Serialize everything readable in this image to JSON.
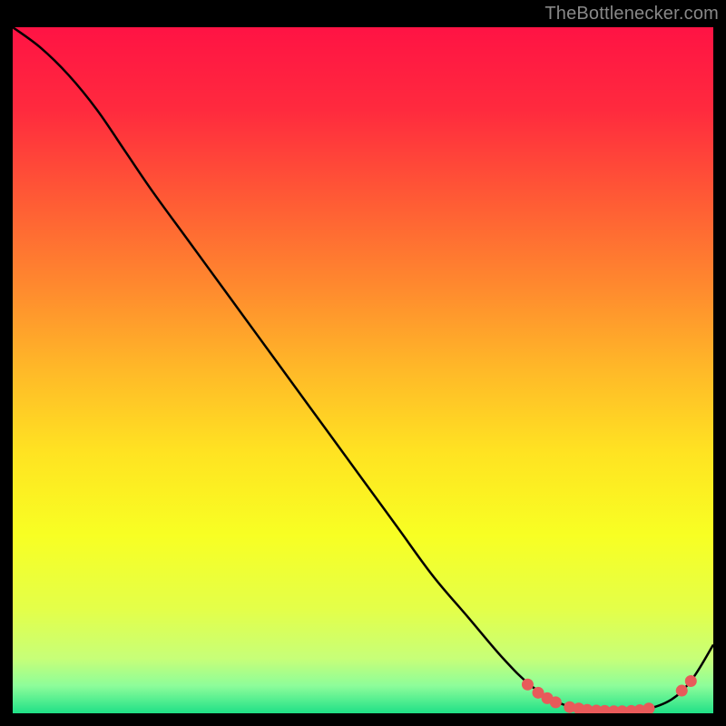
{
  "attribution": "TheBottlenecker.com",
  "chart_data": {
    "type": "line",
    "title": "",
    "xlabel": "",
    "ylabel": "",
    "xlim": [
      0,
      100
    ],
    "ylim": [
      0,
      100
    ],
    "series": [
      {
        "name": "curve",
        "x": [
          0,
          4,
          8,
          12,
          16,
          20,
          25,
          30,
          35,
          40,
          45,
          50,
          55,
          60,
          65,
          70,
          74,
          78,
          82,
          86,
          90,
          94,
          97,
          100
        ],
        "y": [
          100,
          97,
          93,
          88,
          82,
          76,
          69,
          62,
          55,
          48,
          41,
          34,
          27,
          20,
          14,
          8,
          4,
          1.5,
          0.5,
          0.3,
          0.5,
          2,
          5,
          10
        ]
      }
    ],
    "markers": [
      {
        "x": 73.5,
        "y": 4.2
      },
      {
        "x": 75.0,
        "y": 3.0
      },
      {
        "x": 76.3,
        "y": 2.2
      },
      {
        "x": 77.5,
        "y": 1.6
      },
      {
        "x": 79.5,
        "y": 0.9
      },
      {
        "x": 80.8,
        "y": 0.7
      },
      {
        "x": 82.0,
        "y": 0.5
      },
      {
        "x": 83.3,
        "y": 0.4
      },
      {
        "x": 84.5,
        "y": 0.35
      },
      {
        "x": 85.8,
        "y": 0.3
      },
      {
        "x": 87.0,
        "y": 0.3
      },
      {
        "x": 88.3,
        "y": 0.35
      },
      {
        "x": 89.5,
        "y": 0.45
      },
      {
        "x": 90.8,
        "y": 0.7
      },
      {
        "x": 95.5,
        "y": 3.3
      },
      {
        "x": 96.8,
        "y": 4.7
      }
    ],
    "gradient_stops": [
      {
        "offset": 0.0,
        "color": "#ff1344"
      },
      {
        "offset": 0.12,
        "color": "#ff2a3e"
      },
      {
        "offset": 0.25,
        "color": "#ff5a35"
      },
      {
        "offset": 0.38,
        "color": "#ff8a2e"
      },
      {
        "offset": 0.5,
        "color": "#ffb928"
      },
      {
        "offset": 0.62,
        "color": "#ffe322"
      },
      {
        "offset": 0.74,
        "color": "#f8ff23"
      },
      {
        "offset": 0.85,
        "color": "#e3ff4a"
      },
      {
        "offset": 0.92,
        "color": "#c7ff78"
      },
      {
        "offset": 0.96,
        "color": "#8dfd9a"
      },
      {
        "offset": 1.0,
        "color": "#1fe087"
      }
    ],
    "marker_color": "#e85a5a",
    "line_color": "#000000"
  }
}
